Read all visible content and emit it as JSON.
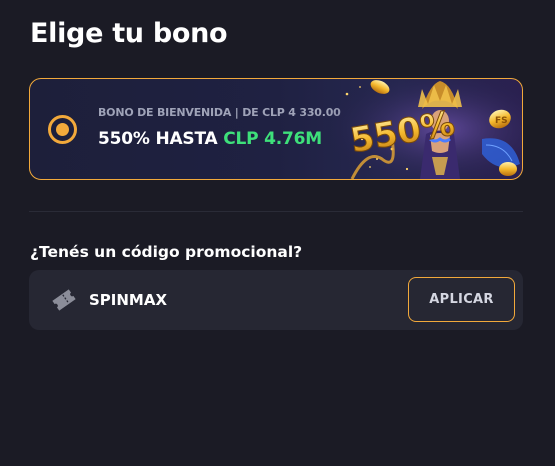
{
  "page": {
    "title": "Elige tu bono"
  },
  "bonus": {
    "subtitle": "BONO DE BIENVENIDA | DE CLP  4 330.00",
    "headline": "550% HASTA",
    "amount": "CLP 4.76M",
    "selected": true,
    "banner_text": "550%",
    "accent_color": "#f2a93b",
    "amount_color": "#3ee07a"
  },
  "promo": {
    "label": "¿Tenés un código promocional?",
    "code_value": "SPINMAX",
    "apply_label": "APLICAR",
    "icon": "ticket-icon"
  }
}
